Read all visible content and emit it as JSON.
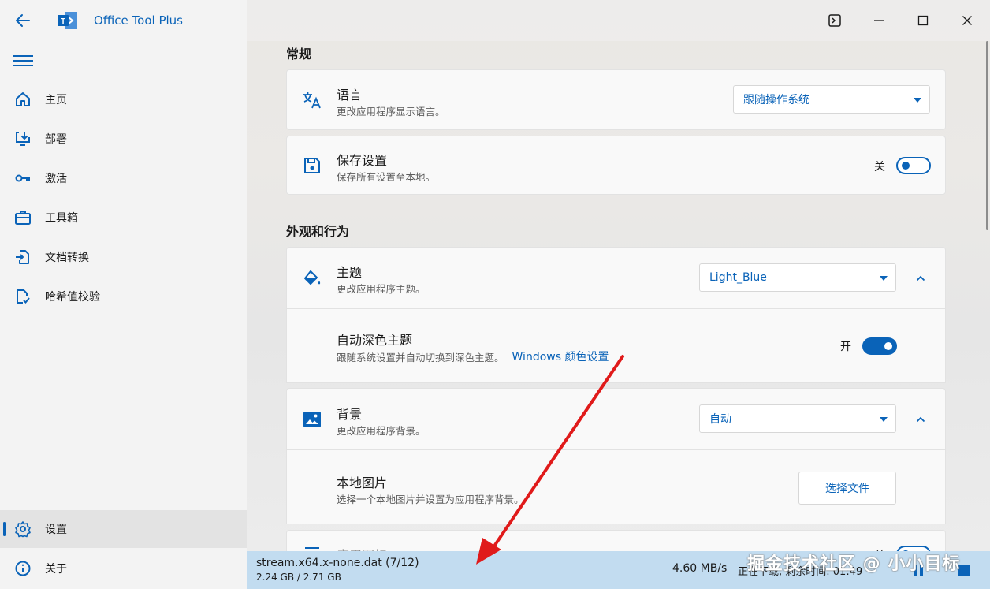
{
  "app": {
    "title": "Office Tool Plus"
  },
  "sidebar": {
    "items": [
      {
        "label": "主页",
        "icon": "home-icon"
      },
      {
        "label": "部署",
        "icon": "deploy-icon"
      },
      {
        "label": "激活",
        "icon": "key-icon"
      },
      {
        "label": "工具箱",
        "icon": "toolbox-icon"
      },
      {
        "label": "文档转换",
        "icon": "document-convert-icon"
      },
      {
        "label": "哈希值校验",
        "icon": "hash-check-icon"
      }
    ],
    "settings_label": "设置",
    "about_label": "关于"
  },
  "sections": {
    "general": "常规",
    "appearance": "外观和行为"
  },
  "settings": {
    "language": {
      "title": "语言",
      "desc": "更改应用程序显示语言。",
      "value": "跟随操作系统"
    },
    "save": {
      "title": "保存设置",
      "desc": "保存所有设置至本地。",
      "toggle_label": "关"
    },
    "theme": {
      "title": "主题",
      "desc": "更改应用程序主题。",
      "value": "Light_Blue"
    },
    "auto_dark": {
      "title": "自动深色主题",
      "desc": "跟随系统设置并自动切换到深色主题。",
      "link": "Windows 颜色设置",
      "toggle_label": "开"
    },
    "background": {
      "title": "背景",
      "desc": "更改应用程序背景。",
      "value": "自动"
    },
    "local_image": {
      "title": "本地图片",
      "desc": "选择一个本地图片并设置为应用程序背景。",
      "button": "选择文件"
    },
    "next_partial": {
      "title": "应用图标",
      "toggle_label": "关"
    }
  },
  "download": {
    "file": "stream.x64.x-none.dat (7/12)",
    "size": "2.24 GB / 2.71 GB",
    "speed": "4.60 MB/s",
    "status": "正在下载, 剩余时间: 01:49"
  },
  "watermark": "掘金技术社区 @ 小小目标",
  "colors": {
    "accent": "#0a63b8",
    "download_bar": "#c2dcf0",
    "annotation_arrow": "#e01a1a"
  }
}
